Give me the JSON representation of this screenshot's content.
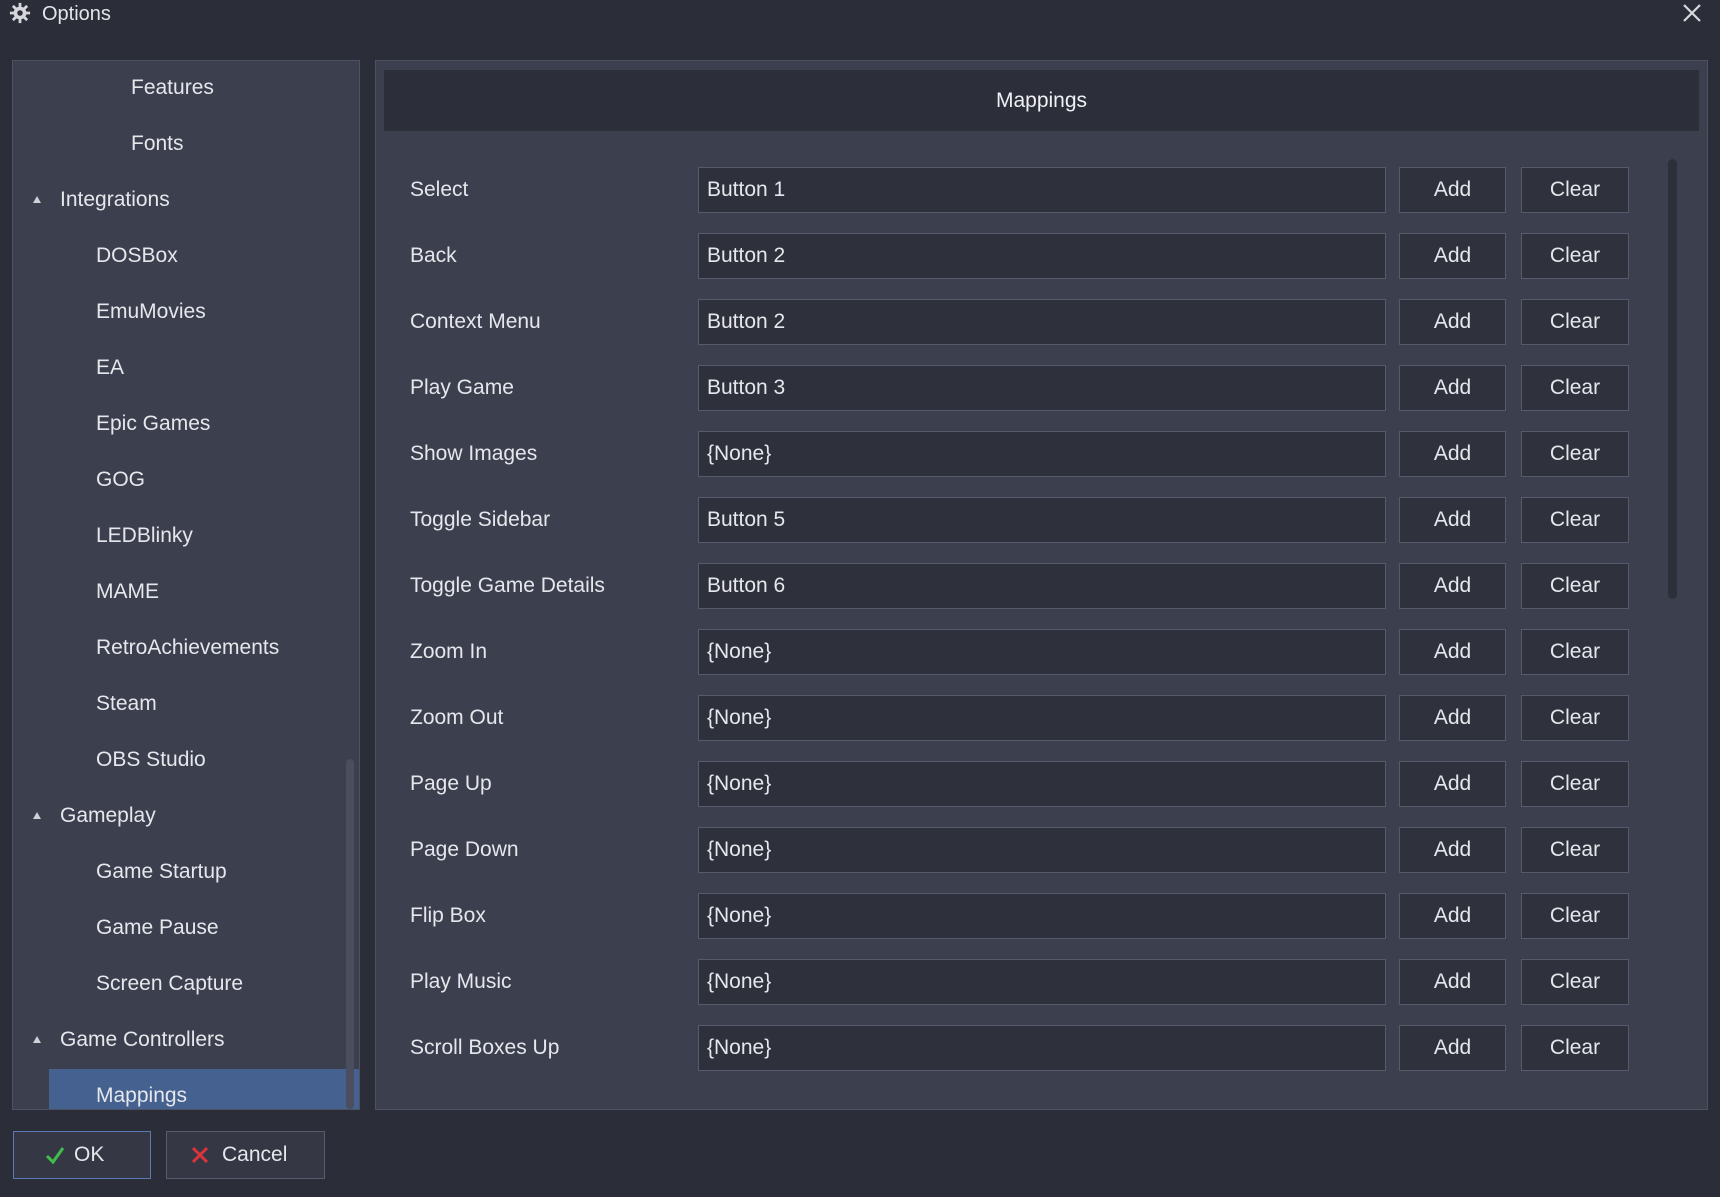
{
  "window": {
    "title": "Options",
    "icon": "gear-icon",
    "close_icon": "close-icon"
  },
  "nav": {
    "items": [
      {
        "label": "Features",
        "level": 2
      },
      {
        "label": "Fonts",
        "level": 2
      },
      {
        "label": "Integrations",
        "level": 0,
        "expanded": true
      },
      {
        "label": "DOSBox",
        "level": 1
      },
      {
        "label": "EmuMovies",
        "level": 1
      },
      {
        "label": "EA",
        "level": 1
      },
      {
        "label": "Epic Games",
        "level": 1
      },
      {
        "label": "GOG",
        "level": 1
      },
      {
        "label": "LEDBlinky",
        "level": 1
      },
      {
        "label": "MAME",
        "level": 1
      },
      {
        "label": "RetroAchievements",
        "level": 1
      },
      {
        "label": "Steam",
        "level": 1
      },
      {
        "label": "OBS Studio",
        "level": 1
      },
      {
        "label": "Gameplay",
        "level": 0,
        "expanded": true
      },
      {
        "label": "Game Startup",
        "level": 1
      },
      {
        "label": "Game Pause",
        "level": 1
      },
      {
        "label": "Screen Capture",
        "level": 1
      },
      {
        "label": "Game Controllers",
        "level": 0,
        "expanded": true
      },
      {
        "label": "Mappings",
        "level": 1,
        "selected": true
      }
    ]
  },
  "content": {
    "header": "Mappings",
    "add_label": "Add",
    "clear_label": "Clear",
    "rows": [
      {
        "label": "Select",
        "value": "Button 1"
      },
      {
        "label": "Back",
        "value": "Button 2"
      },
      {
        "label": "Context Menu",
        "value": "Button 2"
      },
      {
        "label": "Play Game",
        "value": "Button 3"
      },
      {
        "label": "Show Images",
        "value": "{None}"
      },
      {
        "label": "Toggle Sidebar",
        "value": "Button 5"
      },
      {
        "label": "Toggle Game Details",
        "value": "Button 6"
      },
      {
        "label": "Zoom In",
        "value": "{None}"
      },
      {
        "label": "Zoom Out",
        "value": "{None}"
      },
      {
        "label": "Page Up",
        "value": "{None}"
      },
      {
        "label": "Page Down",
        "value": "{None}"
      },
      {
        "label": "Flip Box",
        "value": "{None}"
      },
      {
        "label": "Play Music",
        "value": "{None}"
      },
      {
        "label": "Scroll Boxes Up",
        "value": "{None}"
      }
    ]
  },
  "footer": {
    "ok_label": "OK",
    "ok_icon": "checkmark-icon",
    "cancel_label": "Cancel",
    "cancel_icon": "x-mark-icon"
  },
  "colors": {
    "background": "#2b2d38",
    "panel": "#3c3f4e",
    "selected": "#44618f",
    "ok_check": "#3fbf4a",
    "cancel_x": "#d9343a"
  }
}
